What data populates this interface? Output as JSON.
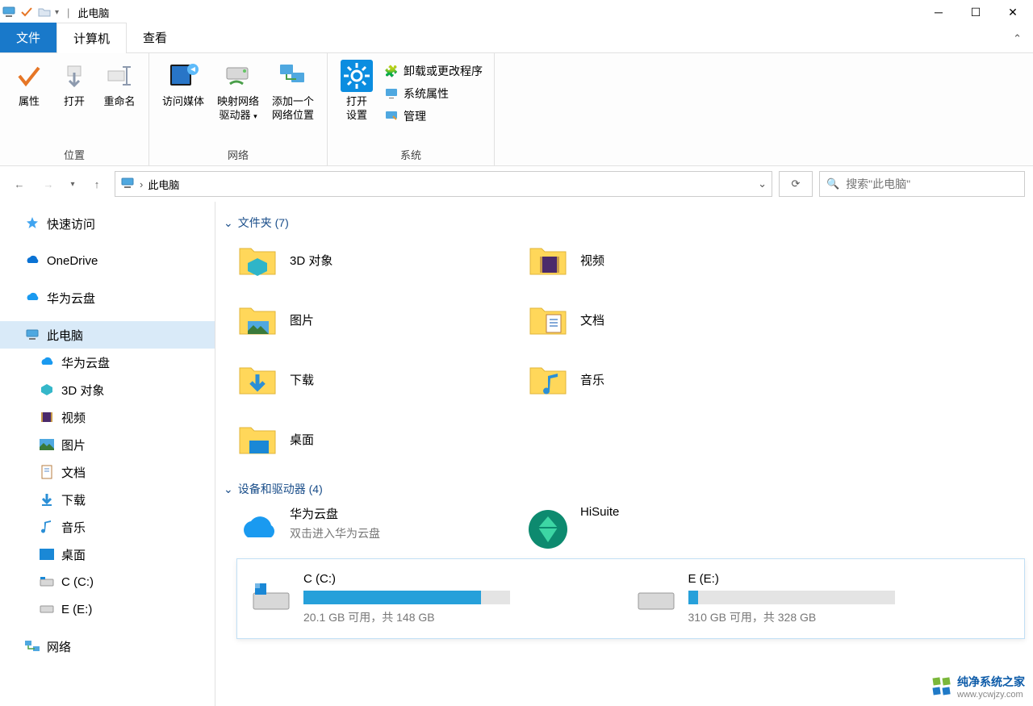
{
  "title": "此电脑",
  "tabs": {
    "file": "文件",
    "computer": "计算机",
    "view": "查看"
  },
  "ribbon": {
    "group_location": "位置",
    "group_network": "网络",
    "group_system": "系统",
    "properties": "属性",
    "open": "打开",
    "rename": "重命名",
    "access_media": "访问媒体",
    "map_drive_l1": "映射网络",
    "map_drive_l2": "驱动器",
    "add_net_l1": "添加一个",
    "add_net_l2": "网络位置",
    "open_settings_l1": "打开",
    "open_settings_l2": "设置",
    "uninstall": "卸载或更改程序",
    "sysprops": "系统属性",
    "manage": "管理"
  },
  "breadcrumb": {
    "location": "此电脑"
  },
  "search": {
    "placeholder": "搜索\"此电脑\""
  },
  "tree": {
    "quick_access": "快速访问",
    "onedrive": "OneDrive",
    "huawei": "华为云盘",
    "this_pc": "此电脑",
    "child_huawei": "华为云盘",
    "child_3d": "3D 对象",
    "child_video": "视频",
    "child_pictures": "图片",
    "child_docs": "文档",
    "child_downloads": "下载",
    "child_music": "音乐",
    "child_desktop": "桌面",
    "child_c": "C (C:)",
    "child_e": "E  (E:)",
    "network": "网络"
  },
  "sections": {
    "folders": "文件夹 (7)",
    "devices": "设备和驱动器 (4)"
  },
  "folders": {
    "f3d": "3D 对象",
    "video": "视频",
    "pictures": "图片",
    "docs": "文档",
    "downloads": "下载",
    "music": "音乐",
    "desktop": "桌面"
  },
  "devices": {
    "huawei_name": "华为云盘",
    "huawei_sub": "双击进入华为云盘",
    "hisuite": "HiSuite"
  },
  "drives": {
    "c_label": "C (C:)",
    "c_stat": "20.1 GB 可用，共 148 GB",
    "c_pct": 86,
    "e_label": "E  (E:)",
    "e_stat": "310 GB 可用，共 328 GB",
    "e_pct": 5
  },
  "watermark": {
    "brand": "纯净系统之家",
    "url": "www.ycwjzy.com"
  }
}
